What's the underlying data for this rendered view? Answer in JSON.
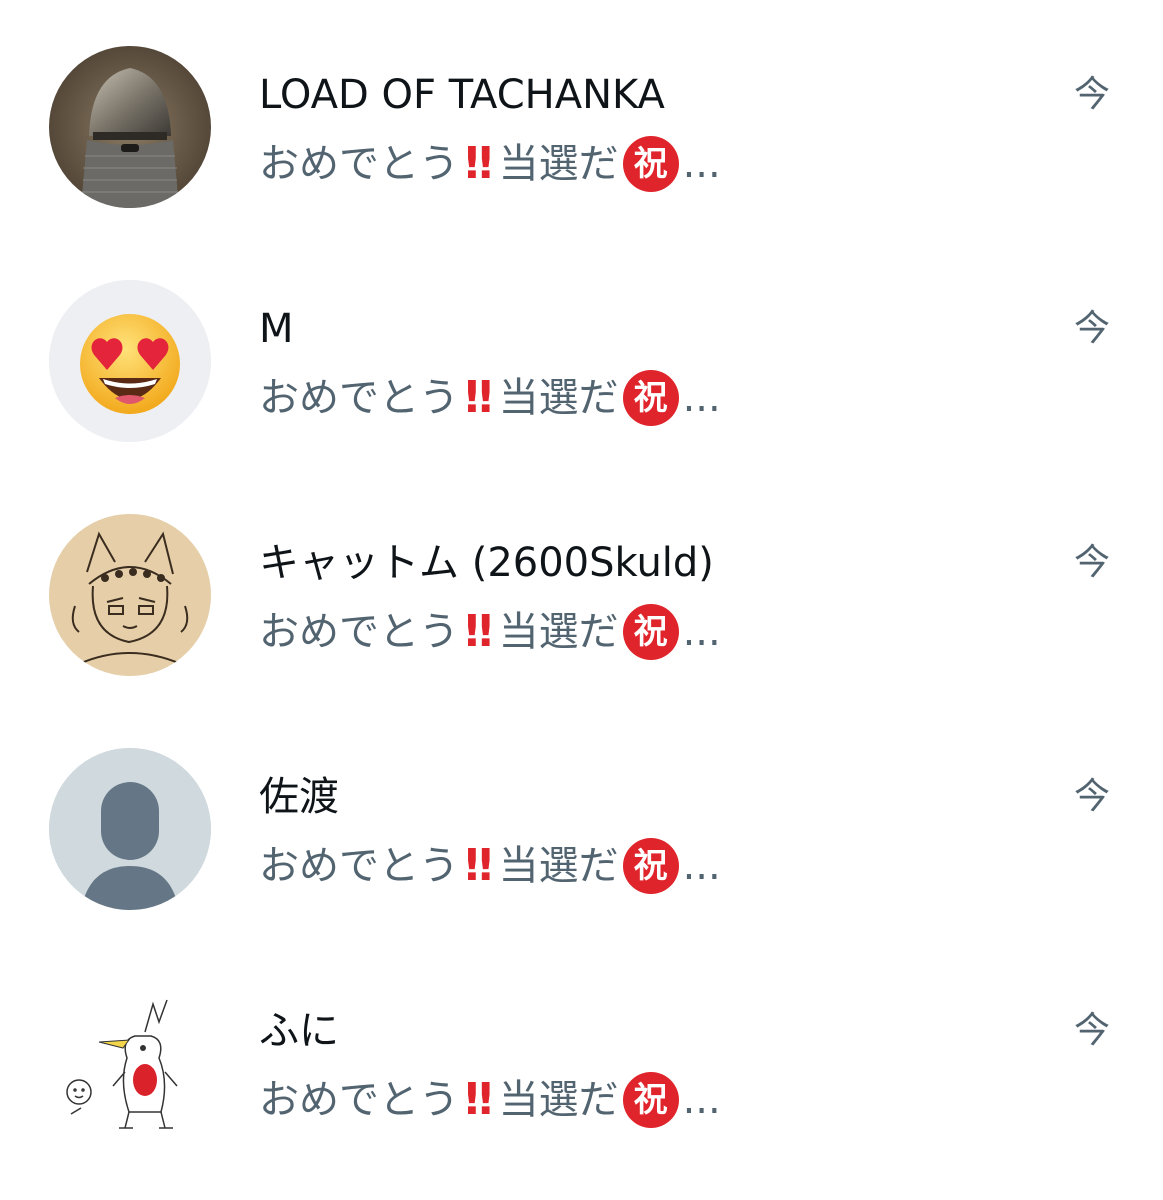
{
  "conversations": [
    {
      "name": "LOAD OF TACHANKA",
      "preview_text": "おめでとう",
      "preview_bang": "‼",
      "preview_text2": "当選だ",
      "preview_badge": "祝",
      "preview_ellipsis": "...",
      "time": "今",
      "avatar_icon": "helmet-photo-avatar"
    },
    {
      "name": "M",
      "preview_text": "おめでとう",
      "preview_bang": "‼",
      "preview_text2": "当選だ",
      "preview_badge": "祝",
      "preview_ellipsis": "...",
      "time": "今",
      "avatar_icon": "heart-eyes-emoji-avatar"
    },
    {
      "name": "キャットム (2600Skuld)",
      "preview_text": "おめでとう",
      "preview_bang": "‼",
      "preview_text2": "当選だ",
      "preview_badge": "祝",
      "preview_ellipsis": "...",
      "time": "今",
      "avatar_icon": "sketch-character-avatar"
    },
    {
      "name": "佐渡",
      "preview_text": "おめでとう",
      "preview_bang": "‼",
      "preview_text2": "当選だ",
      "preview_badge": "祝",
      "preview_ellipsis": "...",
      "time": "今",
      "avatar_icon": "default-person-avatar"
    },
    {
      "name": "ふに",
      "preview_text": "おめでとう",
      "preview_bang": "‼",
      "preview_text2": "当選だ",
      "preview_badge": "祝",
      "preview_ellipsis": "...",
      "time": "今",
      "avatar_icon": "doodle-bird-avatar"
    }
  ],
  "colors": {
    "name": "#0f1419",
    "secondary": "#536471",
    "badge_red": "#e0242b",
    "default_avatar_bg": "#cfd9de",
    "default_avatar_fg": "#657786"
  }
}
